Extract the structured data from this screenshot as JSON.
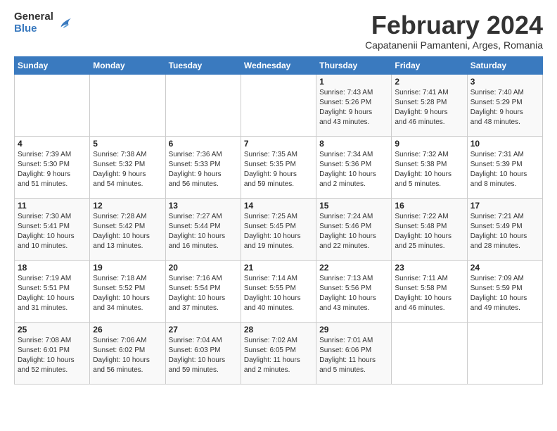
{
  "header": {
    "logo_general": "General",
    "logo_blue": "Blue",
    "month_title": "February 2024",
    "subtitle": "Capatanenii Pamanteni, Arges, Romania"
  },
  "days_of_week": [
    "Sunday",
    "Monday",
    "Tuesday",
    "Wednesday",
    "Thursday",
    "Friday",
    "Saturday"
  ],
  "weeks": [
    [
      {
        "day": "",
        "info": ""
      },
      {
        "day": "",
        "info": ""
      },
      {
        "day": "",
        "info": ""
      },
      {
        "day": "",
        "info": ""
      },
      {
        "day": "1",
        "info": "Sunrise: 7:43 AM\nSunset: 5:26 PM\nDaylight: 9 hours\nand 43 minutes."
      },
      {
        "day": "2",
        "info": "Sunrise: 7:41 AM\nSunset: 5:28 PM\nDaylight: 9 hours\nand 46 minutes."
      },
      {
        "day": "3",
        "info": "Sunrise: 7:40 AM\nSunset: 5:29 PM\nDaylight: 9 hours\nand 48 minutes."
      }
    ],
    [
      {
        "day": "4",
        "info": "Sunrise: 7:39 AM\nSunset: 5:30 PM\nDaylight: 9 hours\nand 51 minutes."
      },
      {
        "day": "5",
        "info": "Sunrise: 7:38 AM\nSunset: 5:32 PM\nDaylight: 9 hours\nand 54 minutes."
      },
      {
        "day": "6",
        "info": "Sunrise: 7:36 AM\nSunset: 5:33 PM\nDaylight: 9 hours\nand 56 minutes."
      },
      {
        "day": "7",
        "info": "Sunrise: 7:35 AM\nSunset: 5:35 PM\nDaylight: 9 hours\nand 59 minutes."
      },
      {
        "day": "8",
        "info": "Sunrise: 7:34 AM\nSunset: 5:36 PM\nDaylight: 10 hours\nand 2 minutes."
      },
      {
        "day": "9",
        "info": "Sunrise: 7:32 AM\nSunset: 5:38 PM\nDaylight: 10 hours\nand 5 minutes."
      },
      {
        "day": "10",
        "info": "Sunrise: 7:31 AM\nSunset: 5:39 PM\nDaylight: 10 hours\nand 8 minutes."
      }
    ],
    [
      {
        "day": "11",
        "info": "Sunrise: 7:30 AM\nSunset: 5:41 PM\nDaylight: 10 hours\nand 10 minutes."
      },
      {
        "day": "12",
        "info": "Sunrise: 7:28 AM\nSunset: 5:42 PM\nDaylight: 10 hours\nand 13 minutes."
      },
      {
        "day": "13",
        "info": "Sunrise: 7:27 AM\nSunset: 5:44 PM\nDaylight: 10 hours\nand 16 minutes."
      },
      {
        "day": "14",
        "info": "Sunrise: 7:25 AM\nSunset: 5:45 PM\nDaylight: 10 hours\nand 19 minutes."
      },
      {
        "day": "15",
        "info": "Sunrise: 7:24 AM\nSunset: 5:46 PM\nDaylight: 10 hours\nand 22 minutes."
      },
      {
        "day": "16",
        "info": "Sunrise: 7:22 AM\nSunset: 5:48 PM\nDaylight: 10 hours\nand 25 minutes."
      },
      {
        "day": "17",
        "info": "Sunrise: 7:21 AM\nSunset: 5:49 PM\nDaylight: 10 hours\nand 28 minutes."
      }
    ],
    [
      {
        "day": "18",
        "info": "Sunrise: 7:19 AM\nSunset: 5:51 PM\nDaylight: 10 hours\nand 31 minutes."
      },
      {
        "day": "19",
        "info": "Sunrise: 7:18 AM\nSunset: 5:52 PM\nDaylight: 10 hours\nand 34 minutes."
      },
      {
        "day": "20",
        "info": "Sunrise: 7:16 AM\nSunset: 5:54 PM\nDaylight: 10 hours\nand 37 minutes."
      },
      {
        "day": "21",
        "info": "Sunrise: 7:14 AM\nSunset: 5:55 PM\nDaylight: 10 hours\nand 40 minutes."
      },
      {
        "day": "22",
        "info": "Sunrise: 7:13 AM\nSunset: 5:56 PM\nDaylight: 10 hours\nand 43 minutes."
      },
      {
        "day": "23",
        "info": "Sunrise: 7:11 AM\nSunset: 5:58 PM\nDaylight: 10 hours\nand 46 minutes."
      },
      {
        "day": "24",
        "info": "Sunrise: 7:09 AM\nSunset: 5:59 PM\nDaylight: 10 hours\nand 49 minutes."
      }
    ],
    [
      {
        "day": "25",
        "info": "Sunrise: 7:08 AM\nSunset: 6:01 PM\nDaylight: 10 hours\nand 52 minutes."
      },
      {
        "day": "26",
        "info": "Sunrise: 7:06 AM\nSunset: 6:02 PM\nDaylight: 10 hours\nand 56 minutes."
      },
      {
        "day": "27",
        "info": "Sunrise: 7:04 AM\nSunset: 6:03 PM\nDaylight: 10 hours\nand 59 minutes."
      },
      {
        "day": "28",
        "info": "Sunrise: 7:02 AM\nSunset: 6:05 PM\nDaylight: 11 hours\nand 2 minutes."
      },
      {
        "day": "29",
        "info": "Sunrise: 7:01 AM\nSunset: 6:06 PM\nDaylight: 11 hours\nand 5 minutes."
      },
      {
        "day": "",
        "info": ""
      },
      {
        "day": "",
        "info": ""
      }
    ]
  ]
}
